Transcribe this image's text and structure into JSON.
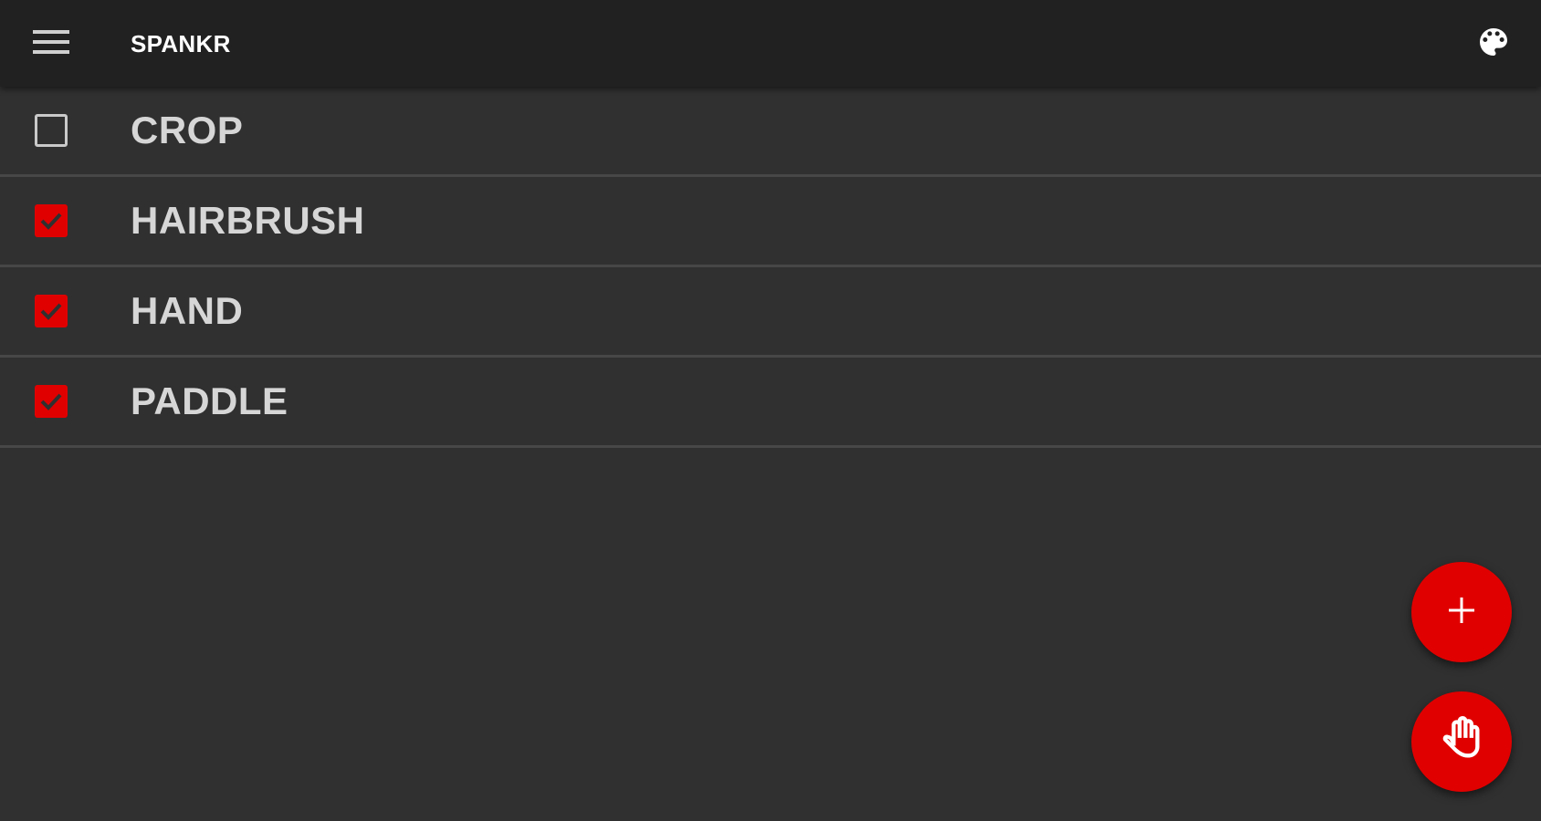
{
  "appbar": {
    "title": "SPANKR",
    "menu_icon": "hamburger-menu-icon",
    "palette_icon": "palette-icon"
  },
  "items": [
    {
      "label": "CROP",
      "checked": false
    },
    {
      "label": "HAIRBRUSH",
      "checked": true
    },
    {
      "label": "HAND",
      "checked": true
    },
    {
      "label": "PADDLE",
      "checked": true
    }
  ],
  "fabs": {
    "add_icon": "plus-icon",
    "action_icon": "hand-icon"
  },
  "colors": {
    "accent": "#e00000",
    "background": "#303030",
    "appbar": "#212121",
    "divider": "#474747",
    "text": "#d6d6d6"
  }
}
